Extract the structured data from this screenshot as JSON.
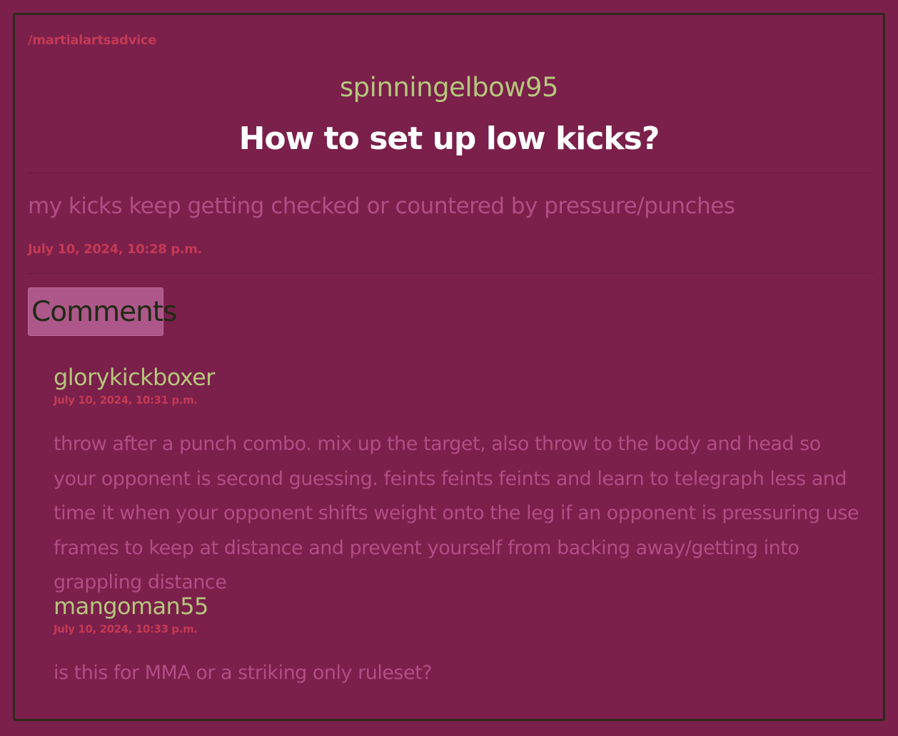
{
  "post": {
    "community": "/martialartsadvice",
    "author": "spinningelbow95",
    "title": "How to set up low kicks?",
    "body": "my kicks keep getting checked or countered by pressure/punches",
    "date": "July 10, 2024, 10:28 p.m."
  },
  "comments_label": "Comments",
  "comments": [
    {
      "author": "glorykickboxer",
      "date": "July 10, 2024, 10:31 p.m.",
      "body": "throw after a punch combo. mix up the target, also throw to the body and head so your opponent is second guessing. feints feints feints and learn to telegraph less and time it when your opponent shifts weight onto the leg if an opponent is pressuring use frames to keep at distance and prevent yourself from backing away/getting into grappling distance"
    },
    {
      "author": "mangoman55",
      "date": "July 10, 2024, 10:33 p.m.",
      "body": "is this for MMA or a striking only ruleset?"
    }
  ],
  "colors": {
    "background": "#7b1f4b",
    "username": "#b5c77c",
    "timestamp": "#c43a55",
    "body_text": "#b14e86",
    "title": "#ffffff",
    "button_bg": "#ad578a"
  }
}
